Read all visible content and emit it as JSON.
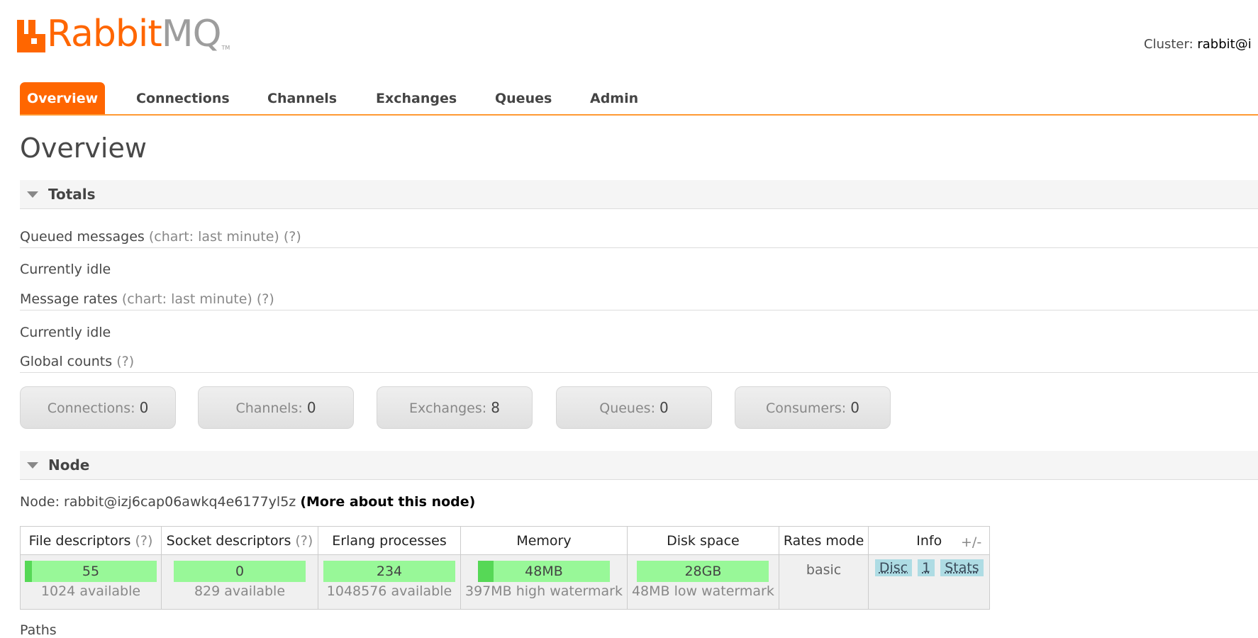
{
  "logo": {
    "part1": "Rabbit",
    "part2": "MQ",
    "tm": "TM"
  },
  "cluster": {
    "label": "Cluster:",
    "value": "rabbit@i"
  },
  "nav": {
    "overview": "Overview",
    "connections": "Connections",
    "channels": "Channels",
    "exchanges": "Exchanges",
    "queues": "Queues",
    "admin": "Admin"
  },
  "page_title": "Overview",
  "totals": {
    "heading": "Totals",
    "queued_messages": {
      "label": "Queued messages",
      "chart": "(chart: last minute)",
      "help": "(?)",
      "status": "Currently idle"
    },
    "message_rates": {
      "label": "Message rates",
      "chart": "(chart: last minute)",
      "help": "(?)",
      "status": "Currently idle"
    },
    "global_counts": {
      "label": "Global counts",
      "help": "(?)"
    },
    "counts": [
      {
        "label": "Connections:",
        "value": "0"
      },
      {
        "label": "Channels:",
        "value": "0"
      },
      {
        "label": "Exchanges:",
        "value": "8"
      },
      {
        "label": "Queues:",
        "value": "0"
      },
      {
        "label": "Consumers:",
        "value": "0"
      }
    ]
  },
  "node": {
    "heading": "Node",
    "prefix": "Node:",
    "name": "rabbit@izj6cap06awkq4e6177yl5z",
    "more_link": "(More about this node)",
    "columns": {
      "file_descriptors": "File descriptors",
      "socket_descriptors": "Socket descriptors",
      "erlang_processes": "Erlang processes",
      "memory": "Memory",
      "disk_space": "Disk space",
      "rates_mode": "Rates mode",
      "info": "Info",
      "help": "(?)"
    },
    "row": {
      "file_descriptors": {
        "value": "55",
        "sub": "1024 available",
        "fill_fraction": 0.054
      },
      "socket_descriptors": {
        "value": "0",
        "sub": "829 available",
        "fill_fraction": 0
      },
      "erlang_processes": {
        "value": "234",
        "sub": "1048576 available",
        "fill_fraction": 0.0002
      },
      "memory": {
        "value": "48MB",
        "sub": "397MB high watermark",
        "fill_fraction": 0.12
      },
      "disk_space": {
        "value": "28GB",
        "sub": "48MB low watermark",
        "fill_fraction": 0
      },
      "rates_mode": "basic",
      "info": [
        "Disc",
        "1",
        "Stats"
      ]
    },
    "plus_minus": "+/-"
  },
  "paths_label": "Paths"
}
